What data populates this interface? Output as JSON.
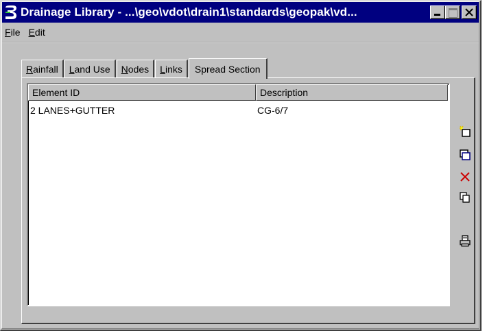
{
  "window": {
    "title": "Drainage Library - ...\\geo\\vdot\\drain1\\standards\\geopak\\vd...",
    "app_icon": "geopak-logo-icon",
    "title_buttons": [
      "minimize-icon",
      "maximize-icon",
      "close-icon"
    ]
  },
  "menu": {
    "file": {
      "hotkey": "F",
      "rest": "ile"
    },
    "edit": {
      "hotkey": "E",
      "rest": "dit"
    }
  },
  "tabs": [
    {
      "hotkey": "R",
      "rest": "ainfall"
    },
    {
      "hotkey": "L",
      "rest": "and Use"
    },
    {
      "hotkey": "N",
      "rest": "odes"
    },
    {
      "hotkey": "L",
      "rest": "inks"
    },
    {
      "label": "Spread Section",
      "active": true
    }
  ],
  "list": {
    "columns": [
      "Element ID",
      "Description"
    ],
    "rows": [
      {
        "element_id": "2 LANES+GUTTER",
        "description": "CG-6/7"
      }
    ]
  },
  "toolbar_icons": [
    "new-item-icon",
    "edit-item-icon",
    "delete-icon",
    "copy-icon",
    "print-icon"
  ],
  "colors": {
    "titlebar": "#000080",
    "face": "#c0c0c0",
    "delete": "#cc0000",
    "accent": "#000080"
  }
}
